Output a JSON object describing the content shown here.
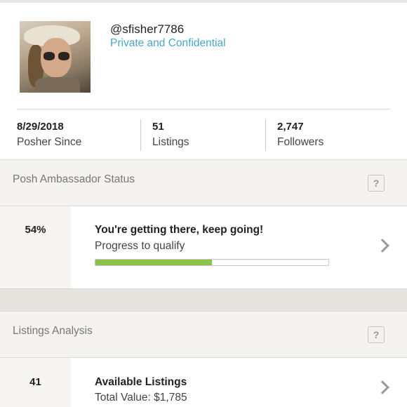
{
  "profile": {
    "username": "@sfisher7786",
    "privacy_label": "Private and Confidential",
    "stats": [
      {
        "value": "8/29/2018",
        "label": "Posher Since"
      },
      {
        "value": "51",
        "label": "Listings"
      },
      {
        "value": "2,747",
        "label": "Followers"
      }
    ]
  },
  "ambassador": {
    "section_title": "Posh Ambassador Status",
    "help_label": "?",
    "percent": "54%",
    "title": "You're getting there, keep going!",
    "subtitle": "Progress to qualify",
    "progress_fraction": 0.5
  },
  "listings_analysis": {
    "section_title": "Listings Analysis",
    "help_label": "?",
    "count": "41",
    "title": "Available Listings",
    "subtitle": "Total Value: $1,785"
  },
  "colors": {
    "link": "#4aa6c9",
    "progress": "#8bc34a"
  }
}
